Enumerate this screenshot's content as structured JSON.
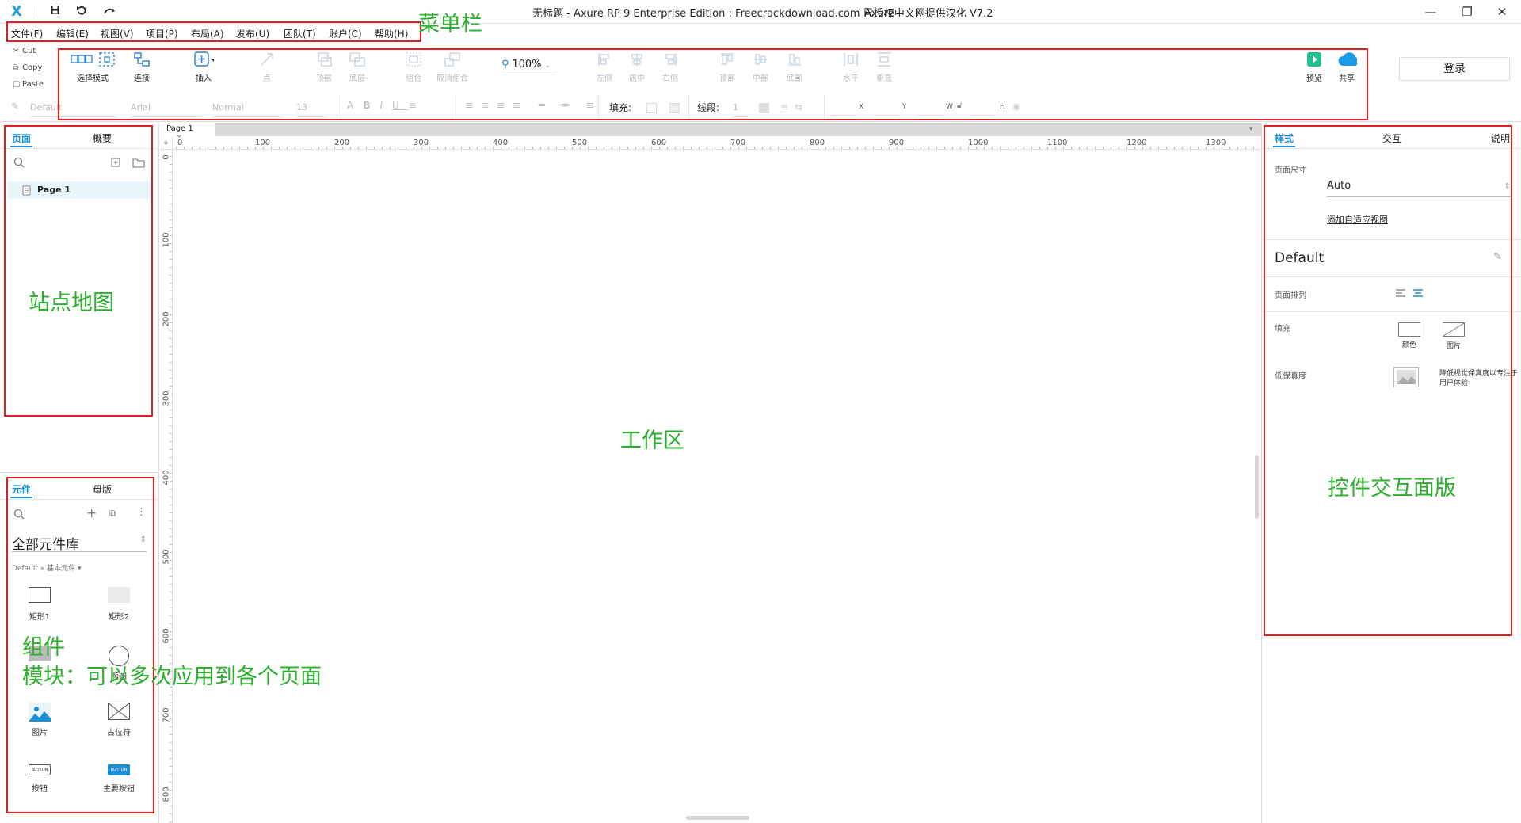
{
  "titlebar": {
    "logo": "X",
    "title": "无标题 - Axure RP 9 Enterprise Edition : Freecrackdownload.com 已授权",
    "localization": "Axure中文网提供汉化 V7.2",
    "win_minimize": "—",
    "win_restore": "❐",
    "win_close": "✕"
  },
  "menu": [
    "文件(F)",
    "编辑(E)",
    "视图(V)",
    "项目(P)",
    "布局(A)",
    "发布(U)",
    "团队(T)",
    "账户(C)",
    "帮助(H)"
  ],
  "clipboard": {
    "cut": "Cut",
    "copy": "Copy",
    "paste": "Paste"
  },
  "toolbar": {
    "select_mode": "选择模式",
    "connect": "连接",
    "insert": "插入",
    "point": "点",
    "top_layer": "顶层",
    "bottom_layer": "底层",
    "group": "组合",
    "ungroup": "取消组合",
    "zoom": "100%",
    "align_left": "左侧",
    "align_center": "居中",
    "align_right": "右侧",
    "align_top": "顶部",
    "align_middle": "中部",
    "align_bottom": "底部",
    "distribute_h": "水平",
    "distribute_v": "垂直",
    "preview": "预览",
    "share": "共享",
    "login": "登录"
  },
  "format": {
    "style": "Default",
    "font": "Arial",
    "weight": "Normal",
    "size": "13",
    "fill_label": "填充:",
    "line_label": "线段:",
    "line_value": "1",
    "x_label": "X",
    "y_label": "Y",
    "w_label": "W",
    "h_label": "H"
  },
  "left_top": {
    "tab_pages": "页面",
    "tab_outline": "概要",
    "page_item": "Page 1"
  },
  "left_bottom": {
    "tab_widgets": "元件",
    "tab_masters": "母版",
    "library": "全部元件库",
    "breadcrumb": "Default » 基本元件 ▾",
    "widgets": [
      "矩形1",
      "矩形2",
      "椭圆",
      "图片",
      "占位符",
      "按钮",
      "主要按钮"
    ],
    "button_text": "BUTTON"
  },
  "canvas": {
    "tab": "Page 1",
    "ruler_h": [
      "0",
      "100",
      "200",
      "300",
      "400",
      "500",
      "600",
      "700",
      "800",
      "900",
      "1000",
      "1100",
      "1200",
      "1300"
    ],
    "ruler_v": [
      "0",
      "100",
      "200",
      "300",
      "400",
      "500",
      "600",
      "700",
      "800"
    ]
  },
  "right": {
    "tab_style": "样式",
    "tab_interact": "交互",
    "tab_notes": "说明",
    "page_size_label": "页面尺寸",
    "page_size_value": "Auto",
    "add_adaptive": "添加自适应视图",
    "default_title": "Default",
    "page_align_label": "页面排列",
    "fill_label": "填充",
    "fill_color": "颜色",
    "fill_image": "图片",
    "low_fi_label": "低保真度",
    "low_fi_desc": "降低视觉保真度以专注于用户体验"
  },
  "annotations": {
    "menubar": "菜单栏",
    "sitemap": "站点地图",
    "workarea": "工作区",
    "inspector": "控件交互面版",
    "widgets": "组件",
    "masters": "模块：可以多次应用到各个页面"
  },
  "colors": {
    "accent": "#1a8fd8",
    "annotation": "#2bb02b",
    "highlight": "#e01f1f",
    "preview_green": "#1fbf8f"
  }
}
